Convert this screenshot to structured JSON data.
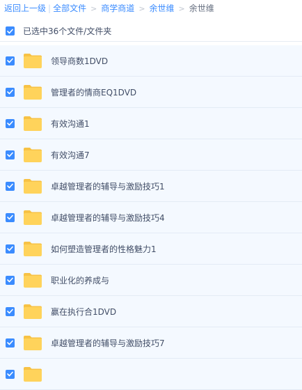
{
  "breadcrumb": {
    "back": "返回上一级",
    "all_files": "全部文件",
    "level1": "商学商道",
    "level2": "余世维",
    "current": "余世维",
    "separator": ">"
  },
  "selection": {
    "label": "已选中36个文件/文件夹",
    "checked": true
  },
  "colors": {
    "accent": "#3b8cff",
    "row_bg": "#f4f9ff",
    "folder": "#ffd35b",
    "folder_tab": "#f7c245"
  },
  "files": [
    {
      "name": "领导商数1DVD",
      "type": "folder-icon",
      "checked": true
    },
    {
      "name": "管理者的情商EQ1DVD",
      "type": "folder-icon",
      "checked": true
    },
    {
      "name": "有效沟通1",
      "type": "folder-icon",
      "checked": true
    },
    {
      "name": "有效沟通7",
      "type": "folder-icon",
      "checked": true
    },
    {
      "name": "卓越管理者的辅导与激励技巧1",
      "type": "folder-icon",
      "checked": true
    },
    {
      "name": "卓越管理者的辅导与激励技巧4",
      "type": "folder-icon",
      "checked": true
    },
    {
      "name": "如何塑造管理者的性格魅力1",
      "type": "folder-icon",
      "checked": true
    },
    {
      "name": "职业化的养成与",
      "type": "folder-icon",
      "checked": true
    },
    {
      "name": "赢在执行合1DVD",
      "type": "folder-icon",
      "checked": true
    },
    {
      "name": "卓越管理者的辅导与激励技巧7",
      "type": "folder-icon",
      "checked": true
    },
    {
      "name": "",
      "type": "folder-icon",
      "checked": true
    }
  ]
}
